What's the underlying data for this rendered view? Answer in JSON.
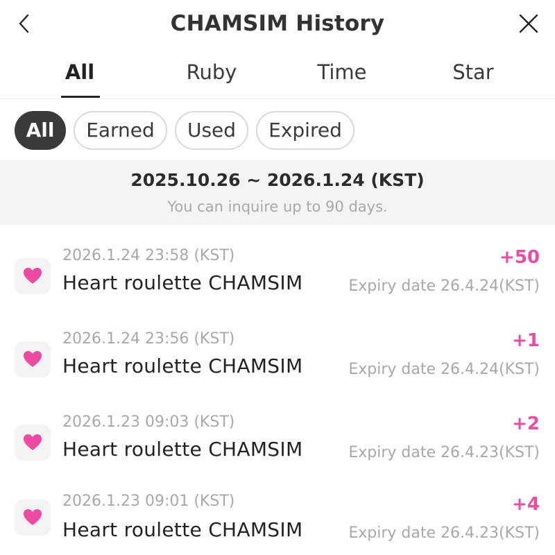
{
  "header": {
    "title": "CHAMSIM History",
    "back_icon": "chevron-left-icon",
    "close_icon": "close-icon"
  },
  "tabs": [
    {
      "label": "All",
      "active": true
    },
    {
      "label": "Ruby",
      "active": false
    },
    {
      "label": "Time",
      "active": false
    },
    {
      "label": "Star",
      "active": false
    }
  ],
  "filters": [
    {
      "label": "All",
      "active": true
    },
    {
      "label": "Earned",
      "active": false
    },
    {
      "label": "Used",
      "active": false
    },
    {
      "label": "Expired",
      "active": false
    }
  ],
  "range": {
    "dates": "2025.10.26 ~ 2026.1.24 (KST)",
    "note": "You can inquire up to 90 days."
  },
  "history": [
    {
      "datetime": "2026.1.24 23:58 (KST)",
      "title": "Heart roulette CHAMSIM",
      "amount": "+50",
      "expiry": "Expiry date 26.4.24(KST)",
      "icon": "heart-icon"
    },
    {
      "datetime": "2026.1.24 23:56 (KST)",
      "title": "Heart roulette CHAMSIM",
      "amount": "+1",
      "expiry": "Expiry date 26.4.24(KST)",
      "icon": "heart-icon"
    },
    {
      "datetime": "2026.1.23 09:03 (KST)",
      "title": "Heart roulette CHAMSIM",
      "amount": "+2",
      "expiry": "Expiry date 26.4.23(KST)",
      "icon": "heart-icon"
    },
    {
      "datetime": "2026.1.23 09:01 (KST)",
      "title": "Heart roulette CHAMSIM",
      "amount": "+4",
      "expiry": "Expiry date 26.4.23(KST)",
      "icon": "heart-icon"
    }
  ],
  "colors": {
    "accent": "#ef4aa3",
    "chip_active": "#3a3a3a",
    "muted_text": "#a8a8a8",
    "banner_bg": "#f4f4f4"
  }
}
